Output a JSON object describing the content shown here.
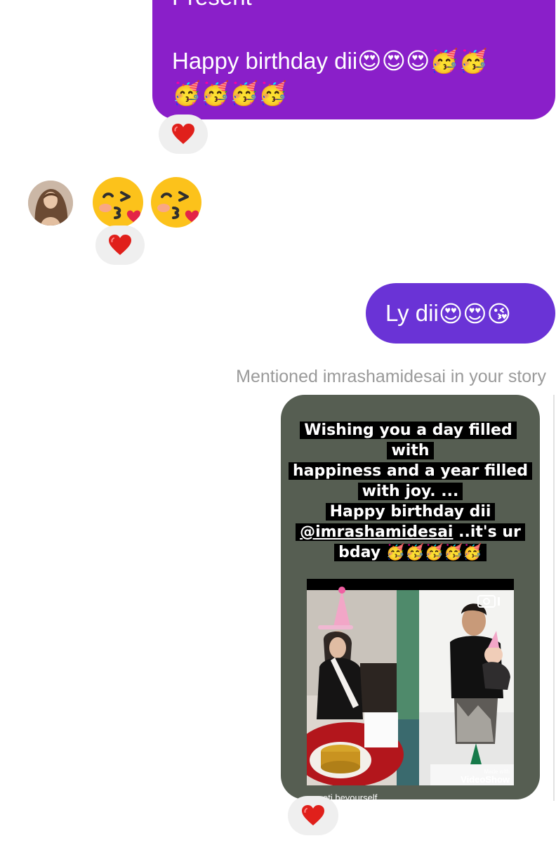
{
  "thread": {
    "top_message": {
      "partial_text": "Present",
      "text": "Happy birthday dii",
      "emojis": [
        "😍",
        "😍",
        "😍",
        "🥳",
        "🥳",
        "🥳",
        "🥳",
        "🥳",
        "🥳"
      ]
    },
    "incoming_message": {
      "emojis": [
        "😘",
        "😘"
      ]
    },
    "ly_message": {
      "text": "Ly dii",
      "emojis": [
        "😍",
        "😍",
        "😘"
      ]
    },
    "story_reply": {
      "caption": "Mentioned imrashamidesai in your story",
      "story_lines": {
        "l1": "Wishing you a day filled with",
        "l2": "happiness and a year filled",
        "l3": "with joy. ...",
        "l4": "Happy birthday dii",
        "l5_mention": "@imrashamidesai",
        "l5_rest": " ..it's ur",
        "l6": "bday ",
        "l6_emojis": "🥳🥳🥳🥳🥳"
      },
      "watermark_made": "Made with",
      "watermark_brand": "VideoShow",
      "footer_text": "oti beyourself"
    },
    "reaction_emoji": "heart",
    "accent_colors": {
      "outgoing_purple": "#8a1fc9",
      "outgoing_violet": "#6a33d6",
      "story_bg": "#565e52"
    }
  }
}
